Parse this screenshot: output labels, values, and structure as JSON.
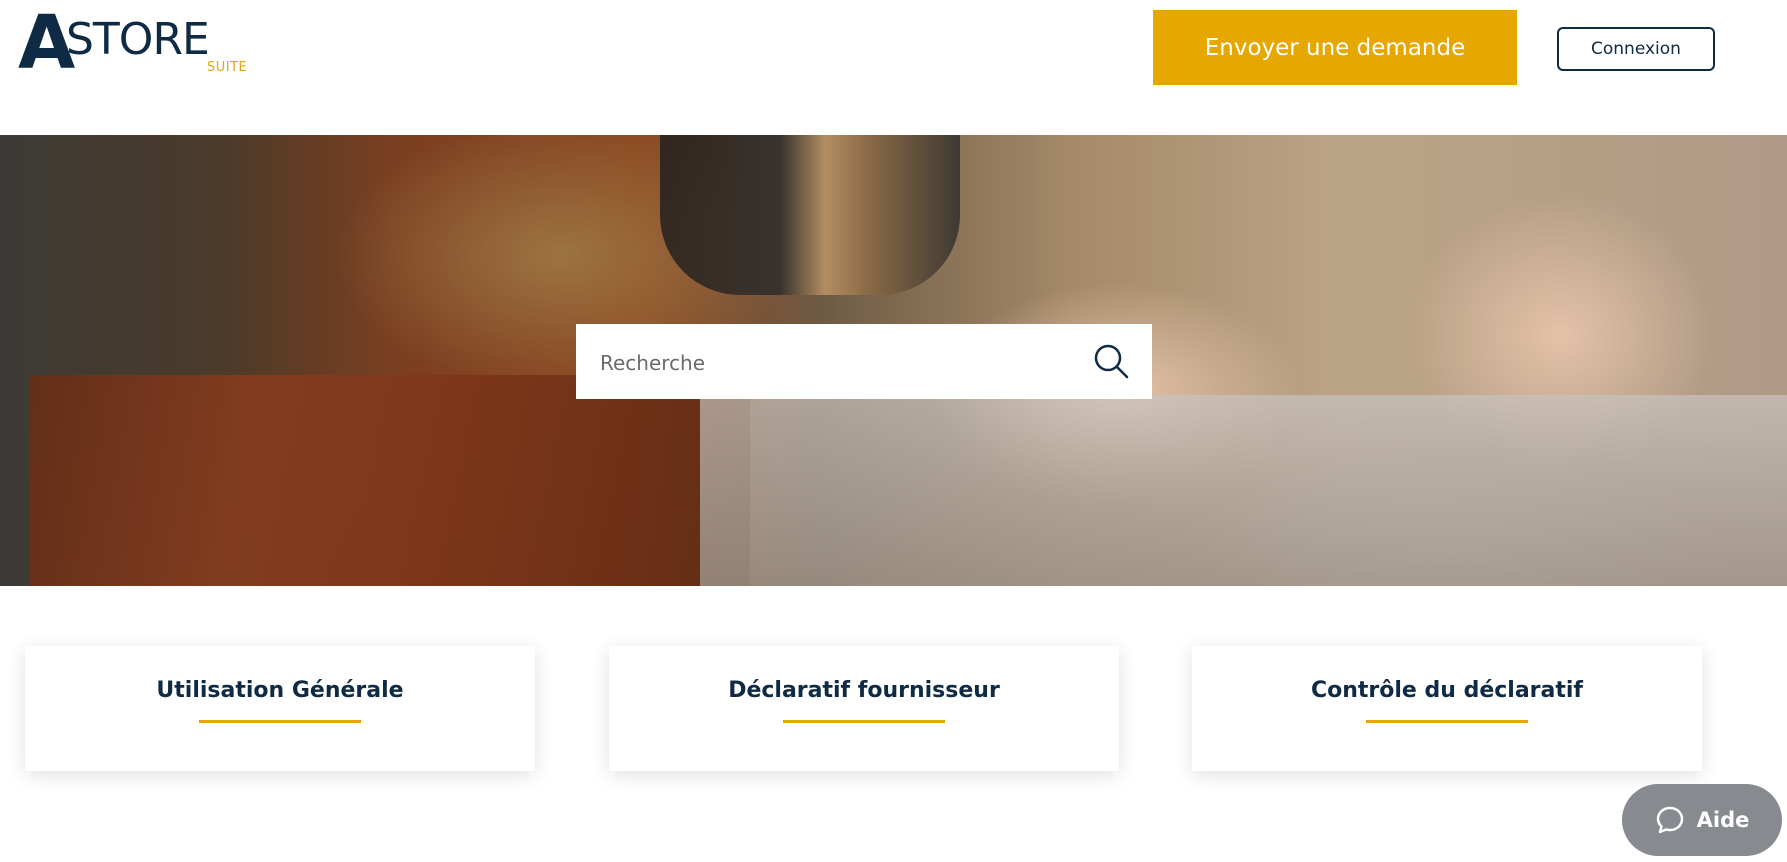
{
  "logo": {
    "letter": "A",
    "word": "STORE",
    "sub": "SUITE"
  },
  "header": {
    "primary_button": "Envoyer une demande",
    "login_button": "Connexion"
  },
  "search": {
    "placeholder": "Recherche"
  },
  "categories": [
    {
      "title": "Utilisation Générale"
    },
    {
      "title": "Déclaratif fournisseur"
    },
    {
      "title": "Contrôle du déclaratif"
    }
  ],
  "help": {
    "label": "Aide"
  },
  "colors": {
    "brand_navy": "#0f2a44",
    "accent": "#e6a700",
    "help_bg": "#878b8f"
  }
}
